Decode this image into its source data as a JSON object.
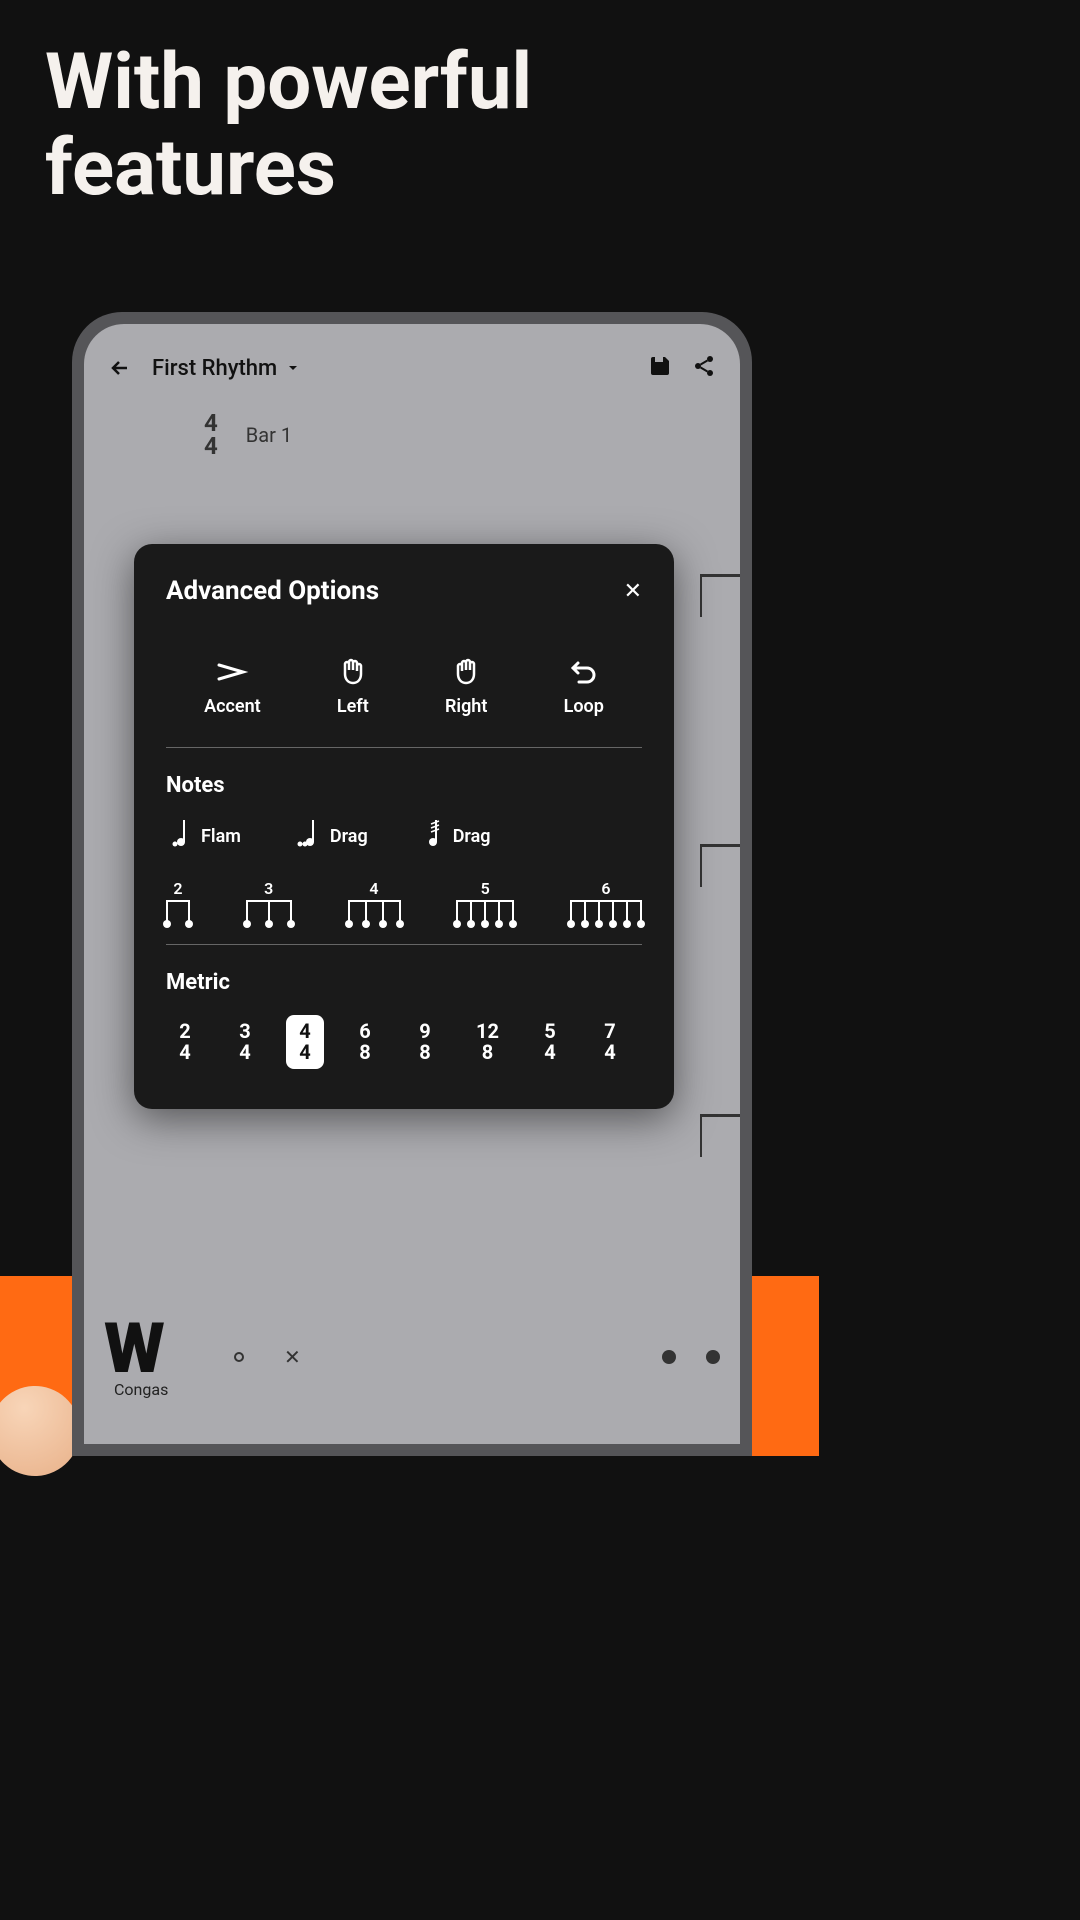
{
  "headline_line1": "With powerful",
  "headline_line2": "features",
  "app": {
    "title": "First Rhythm",
    "timesig_top": "4",
    "timesig_bottom": "4",
    "bar_label": "Bar 1",
    "track_label": "Congas"
  },
  "modal": {
    "title": "Advanced Options",
    "options": [
      {
        "label": "Accent"
      },
      {
        "label": "Left"
      },
      {
        "label": "Right"
      },
      {
        "label": "Loop"
      }
    ],
    "section_notes": "Notes",
    "notes": [
      {
        "label": "Flam"
      },
      {
        "label": "Drag"
      },
      {
        "label": "Drag"
      }
    ],
    "tuplets": [
      "2",
      "3",
      "4",
      "5",
      "6"
    ],
    "section_metric": "Metric",
    "metrics": [
      {
        "top": "2",
        "bottom": "4",
        "selected": false
      },
      {
        "top": "3",
        "bottom": "4",
        "selected": false
      },
      {
        "top": "4",
        "bottom": "4",
        "selected": true
      },
      {
        "top": "6",
        "bottom": "8",
        "selected": false
      },
      {
        "top": "9",
        "bottom": "8",
        "selected": false
      },
      {
        "top": "12",
        "bottom": "8",
        "selected": false
      },
      {
        "top": "5",
        "bottom": "4",
        "selected": false
      },
      {
        "top": "7",
        "bottom": "4",
        "selected": false
      }
    ]
  }
}
